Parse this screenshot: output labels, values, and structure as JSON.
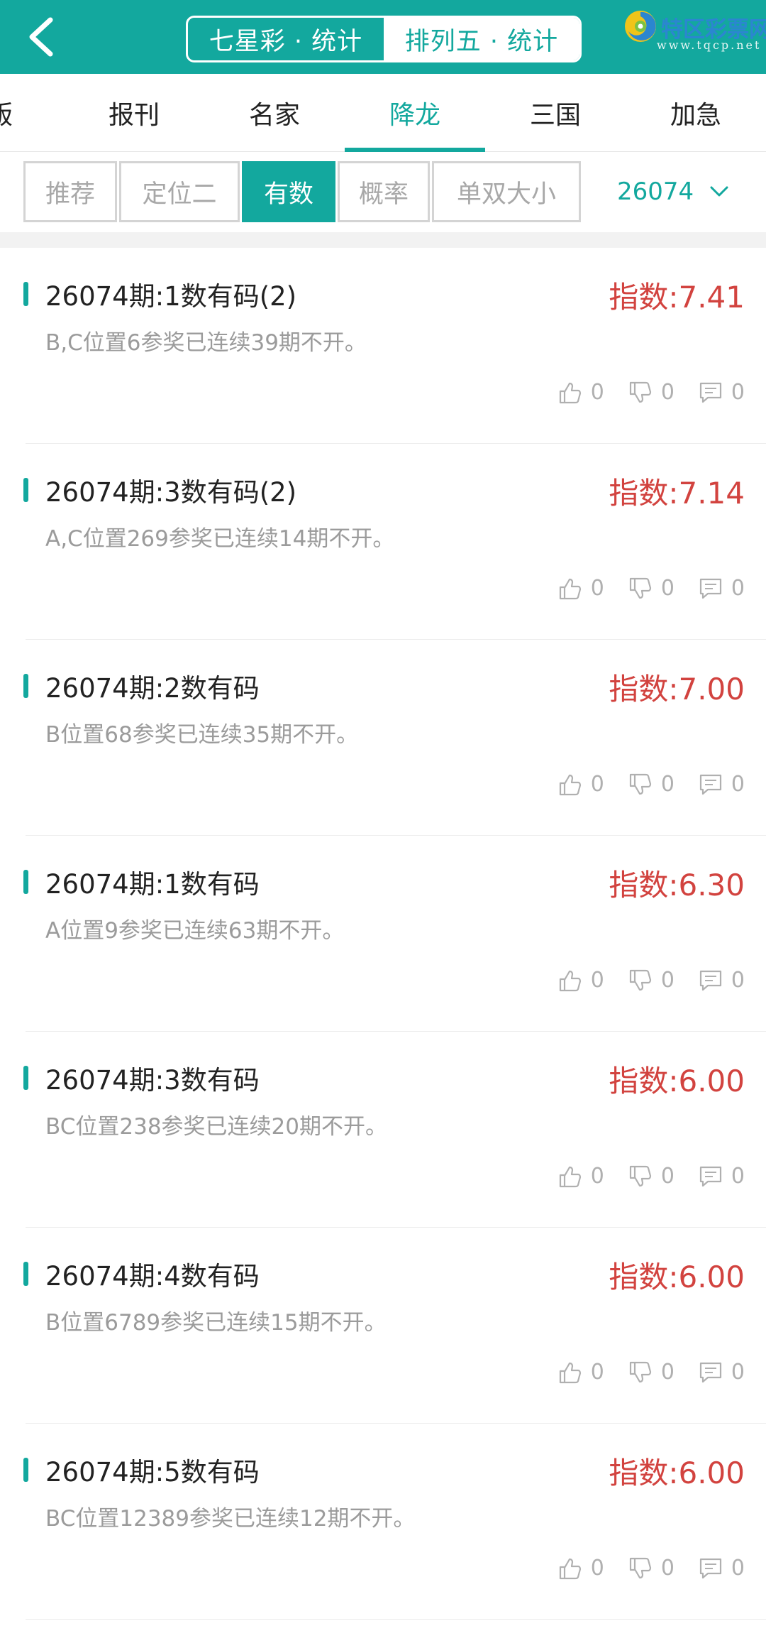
{
  "header": {
    "segments": [
      "七星彩 · 统计",
      "排列五 · 统计"
    ],
    "logo_title": "特区彩票网",
    "logo_url": "www.tqcp.net",
    "brand_color": "#13a89e"
  },
  "nav": {
    "tabs": [
      "版",
      "报刊",
      "名家",
      "降龙",
      "三国",
      "加急"
    ],
    "active": "降龙"
  },
  "filter": {
    "buttons": [
      "推荐",
      "定位二",
      "有数",
      "概率",
      "单双大小"
    ],
    "active": "有数",
    "period": "26074"
  },
  "items": [
    {
      "title": "26074期:1数有码(2)",
      "score": "指数:7.41",
      "desc": "B,C位置6参奖已连续39期不开。",
      "likes": "0",
      "dislikes": "0",
      "comments": "0"
    },
    {
      "title": "26074期:3数有码(2)",
      "score": "指数:7.14",
      "desc": "A,C位置269参奖已连续14期不开。",
      "likes": "0",
      "dislikes": "0",
      "comments": "0"
    },
    {
      "title": "26074期:2数有码",
      "score": "指数:7.00",
      "desc": "B位置68参奖已连续35期不开。",
      "likes": "0",
      "dislikes": "0",
      "comments": "0"
    },
    {
      "title": "26074期:1数有码",
      "score": "指数:6.30",
      "desc": "A位置9参奖已连续63期不开。",
      "likes": "0",
      "dislikes": "0",
      "comments": "0"
    },
    {
      "title": "26074期:3数有码",
      "score": "指数:6.00",
      "desc": "BC位置238参奖已连续20期不开。",
      "likes": "0",
      "dislikes": "0",
      "comments": "0"
    },
    {
      "title": "26074期:4数有码",
      "score": "指数:6.00",
      "desc": "B位置6789参奖已连续15期不开。",
      "likes": "0",
      "dislikes": "0",
      "comments": "0"
    },
    {
      "title": "26074期:5数有码",
      "score": "指数:6.00",
      "desc": "BC位置12389参奖已连续12期不开。",
      "likes": "0",
      "dislikes": "0",
      "comments": "0"
    }
  ],
  "colors": {
    "accent": "#13a89e",
    "score": "#d2433f",
    "muted": "#9b9b9b"
  }
}
